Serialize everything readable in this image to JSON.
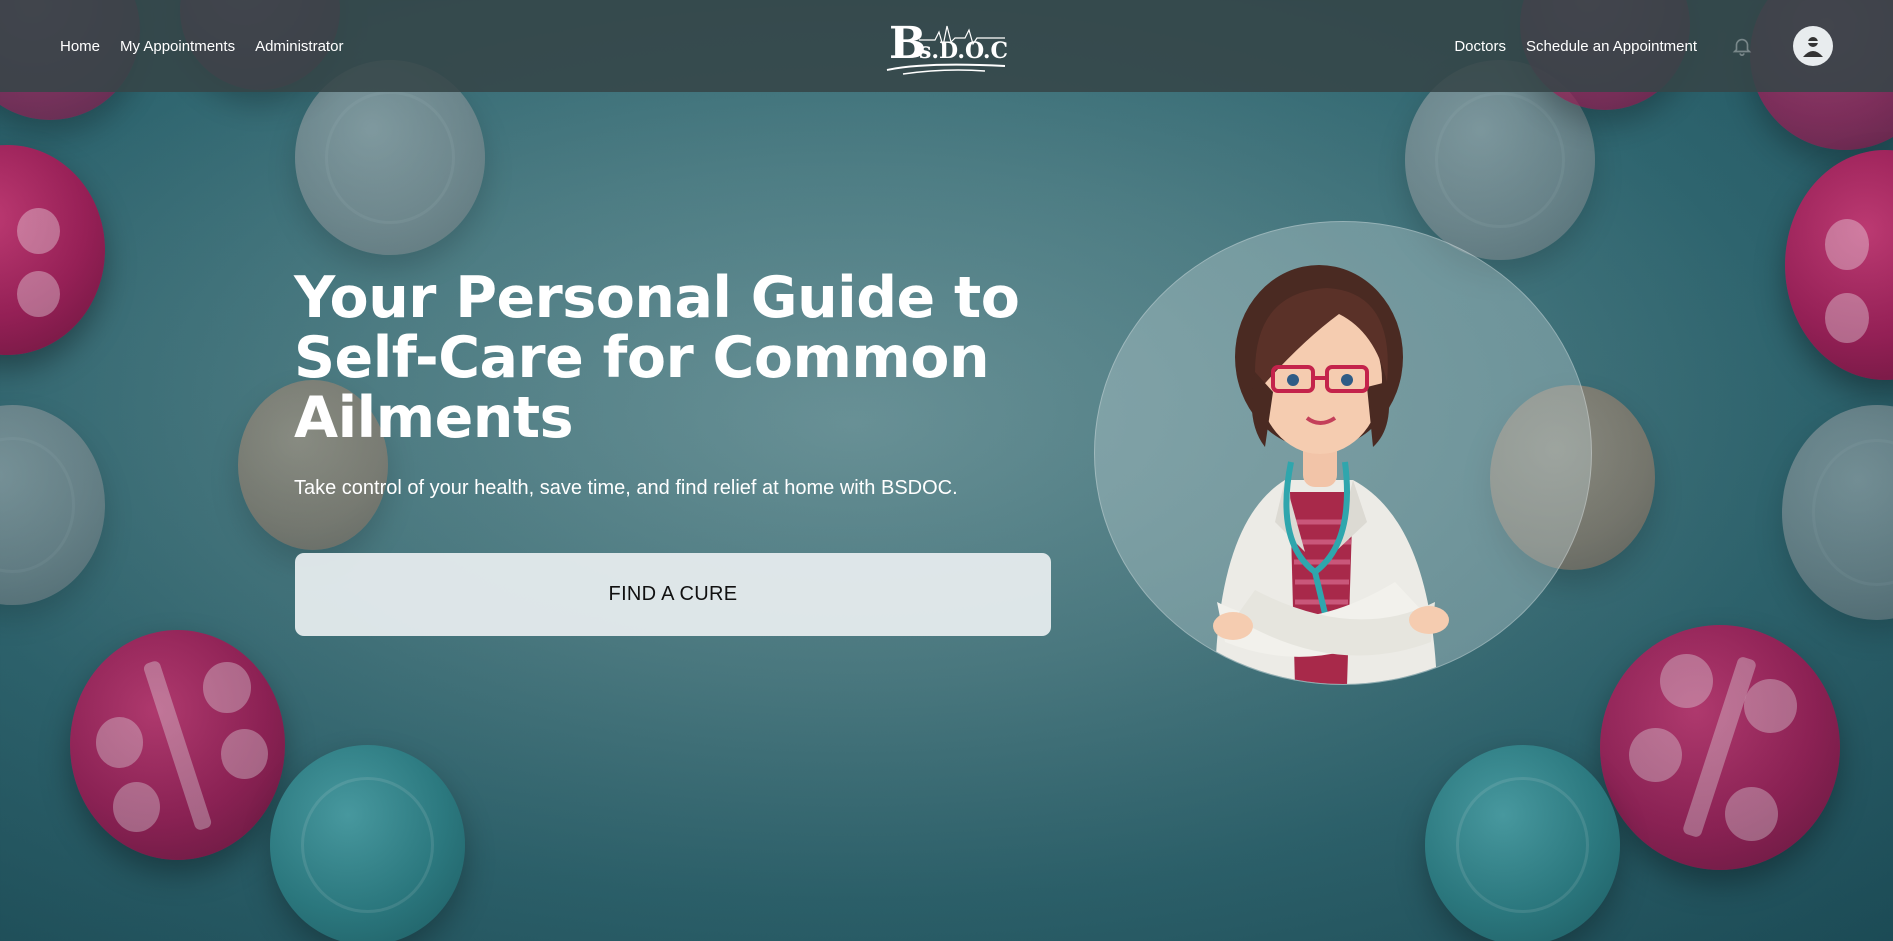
{
  "header": {
    "nav_left": [
      "Home",
      "My Appointments",
      "Administrator"
    ],
    "logo_text": "Bs.D.O.C",
    "nav_right": [
      "Doctors",
      "Schedule an Appointment"
    ],
    "bell_icon": "bell-icon",
    "avatar_icon": "user-avatar-icon"
  },
  "hero": {
    "title": "Your Personal Guide to Self-Care for Common Ailments",
    "subtitle": "Take control of your health, save time, and find relief at home with BSDOC.",
    "cta_label": "FIND A CURE"
  },
  "colors": {
    "header_bg": "#364648",
    "cta_bg": "#e8eef0",
    "pill_pink": "#9b1f57",
    "bg_teal": "#4f7f86"
  }
}
